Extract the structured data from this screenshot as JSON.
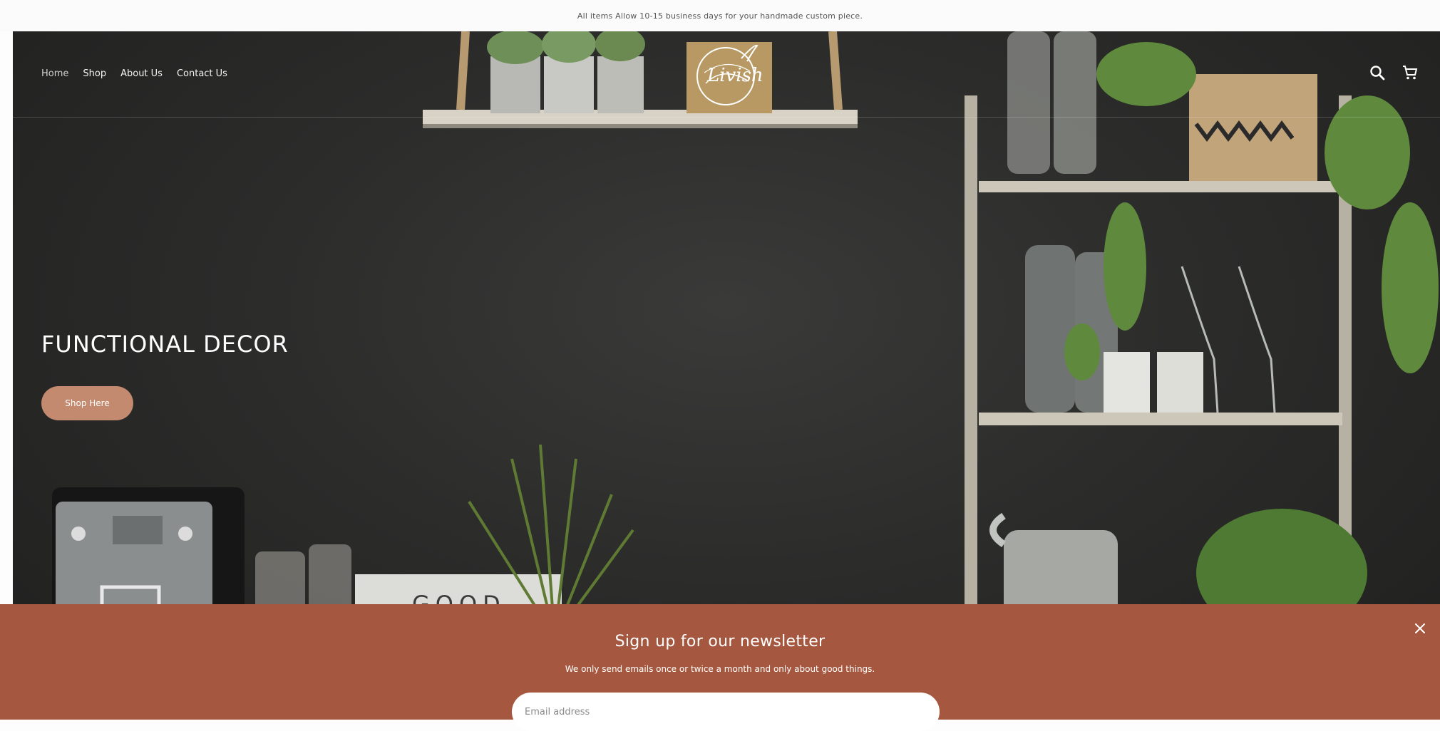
{
  "announcement": {
    "text": "All items Allow 10-15 business days for your handmade custom piece."
  },
  "header": {
    "nav": [
      {
        "label": "Home"
      },
      {
        "label": "Shop"
      },
      {
        "label": "About Us"
      },
      {
        "label": "Contact Us"
      }
    ],
    "logo_text": "Livish",
    "icons": [
      "search-icon",
      "cart-icon"
    ]
  },
  "hero": {
    "title": "FUNCTIONAL DECOR",
    "button_label": "Shop Here",
    "button_color": "#c38a70"
  },
  "newsletter": {
    "title": "Sign up for our newsletter",
    "subtitle": "We only send emails once or twice a month and only about good things.",
    "email_placeholder": "Email address",
    "background_color": "#a5583f"
  }
}
